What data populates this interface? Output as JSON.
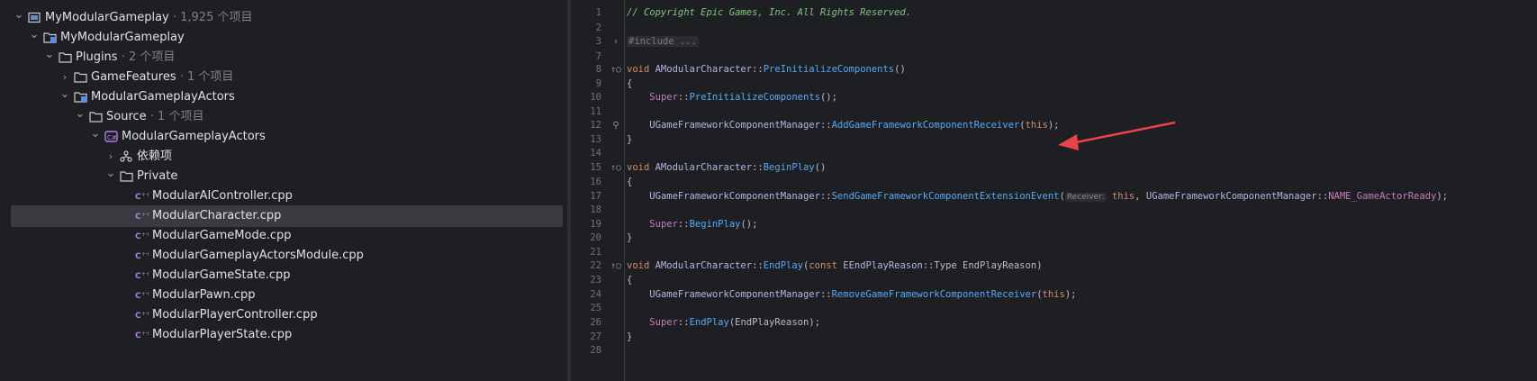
{
  "tree": [
    {
      "label": "MyModularGameplay",
      "meta": "· 1,925 个项目",
      "icon": "solution-icon",
      "chevron": "down",
      "depth": 0
    },
    {
      "label": "MyModularGameplay",
      "meta": "",
      "icon": "project-icon",
      "chevron": "down",
      "depth": 1
    },
    {
      "label": "Plugins",
      "meta": "· 2 个项目",
      "icon": "folder-icon",
      "chevron": "down",
      "depth": 2
    },
    {
      "label": "GameFeatures",
      "meta": "· 1 个项目",
      "icon": "folder-icon",
      "chevron": "right",
      "depth": 3
    },
    {
      "label": "ModularGameplayActors",
      "meta": "",
      "icon": "project-icon",
      "chevron": "down",
      "depth": 3
    },
    {
      "label": "Source",
      "meta": "· 1 个项目",
      "icon": "folder-icon",
      "chevron": "down",
      "depth": 4
    },
    {
      "label": "ModularGameplayActors",
      "meta": "",
      "icon": "cpp-project-icon",
      "chevron": "down",
      "depth": 5
    },
    {
      "label": "依赖项",
      "meta": "",
      "icon": "dependencies-icon",
      "chevron": "right",
      "depth": 6
    },
    {
      "label": "Private",
      "meta": "",
      "icon": "folder-icon",
      "chevron": "down",
      "depth": 6
    },
    {
      "label": "ModularAIController.cpp",
      "meta": "",
      "icon": "cpp-file-icon",
      "chevron": "",
      "depth": 7
    },
    {
      "label": "ModularCharacter.cpp",
      "meta": "",
      "icon": "cpp-file-icon",
      "chevron": "",
      "depth": 7,
      "selected": true
    },
    {
      "label": "ModularGameMode.cpp",
      "meta": "",
      "icon": "cpp-file-icon",
      "chevron": "",
      "depth": 7
    },
    {
      "label": "ModularGameplayActorsModule.cpp",
      "meta": "",
      "icon": "cpp-file-icon",
      "chevron": "",
      "depth": 7
    },
    {
      "label": "ModularGameState.cpp",
      "meta": "",
      "icon": "cpp-file-icon",
      "chevron": "",
      "depth": 7
    },
    {
      "label": "ModularPawn.cpp",
      "meta": "",
      "icon": "cpp-file-icon",
      "chevron": "",
      "depth": 7
    },
    {
      "label": "ModularPlayerController.cpp",
      "meta": "",
      "icon": "cpp-file-icon",
      "chevron": "",
      "depth": 7
    },
    {
      "label": "ModularPlayerState.cpp",
      "meta": "",
      "icon": "cpp-file-icon",
      "chevron": "",
      "depth": 7
    }
  ],
  "code": [
    {
      "ln": "1",
      "gutter": "",
      "tokens": [
        [
          "c-comment",
          "// Copyright Epic Games, Inc. All Rights Reserved."
        ]
      ]
    },
    {
      "ln": "2",
      "gutter": "",
      "tokens": []
    },
    {
      "ln": "3",
      "gutter": "›",
      "tokens": [
        [
          "c-fold",
          "#include ..."
        ]
      ]
    },
    {
      "ln": "7",
      "gutter": "",
      "tokens": []
    },
    {
      "ln": "8",
      "gutter": "↑○",
      "tokens": [
        [
          "c-kw",
          "void "
        ],
        [
          "c-cls",
          "AModularCharacter"
        ],
        [
          "",
          "::"
        ],
        [
          "c-fn",
          "PreInitializeComponents"
        ],
        [
          "",
          "()"
        ]
      ]
    },
    {
      "ln": "9",
      "gutter": "",
      "tokens": [
        [
          "",
          "{"
        ]
      ]
    },
    {
      "ln": "10",
      "gutter": "",
      "tokens": [
        [
          "",
          "    "
        ],
        [
          "c-type",
          "Super"
        ],
        [
          "",
          "::"
        ],
        [
          "c-call",
          "PreInitializeComponents"
        ],
        [
          "",
          "();"
        ]
      ]
    },
    {
      "ln": "11",
      "gutter": "",
      "tokens": []
    },
    {
      "ln": "12",
      "gutter": "⚲",
      "tokens": [
        [
          "",
          "    "
        ],
        [
          "c-cls",
          "UGameFrameworkComponentManager"
        ],
        [
          "",
          "::"
        ],
        [
          "c-call",
          "AddGameFrameworkComponentReceiver"
        ],
        [
          "",
          "("
        ],
        [
          "c-kw",
          "this"
        ],
        [
          "",
          ");"
        ]
      ]
    },
    {
      "ln": "13",
      "gutter": "",
      "tokens": [
        [
          "",
          "}"
        ]
      ]
    },
    {
      "ln": "14",
      "gutter": "",
      "tokens": []
    },
    {
      "ln": "15",
      "gutter": "↑○",
      "tokens": [
        [
          "c-kw",
          "void "
        ],
        [
          "c-cls",
          "AModularCharacter"
        ],
        [
          "",
          "::"
        ],
        [
          "c-fn",
          "BeginPlay"
        ],
        [
          "",
          "()"
        ]
      ]
    },
    {
      "ln": "16",
      "gutter": "",
      "tokens": [
        [
          "",
          "{"
        ]
      ]
    },
    {
      "ln": "17",
      "gutter": "",
      "tokens": [
        [
          "",
          "    "
        ],
        [
          "c-cls",
          "UGameFrameworkComponentManager"
        ],
        [
          "",
          "::"
        ],
        [
          "c-call",
          "SendGameFrameworkComponentExtensionEvent"
        ],
        [
          "",
          "("
        ],
        [
          "hint",
          "Receiver:"
        ],
        [
          "c-kw",
          " this"
        ],
        [
          "",
          ", "
        ],
        [
          "c-cls",
          "UGameFrameworkComponentManager"
        ],
        [
          "",
          "::"
        ],
        [
          "c-mem",
          "NAME_GameActorReady"
        ],
        [
          "",
          ");"
        ]
      ]
    },
    {
      "ln": "18",
      "gutter": "",
      "tokens": []
    },
    {
      "ln": "19",
      "gutter": "",
      "tokens": [
        [
          "",
          "    "
        ],
        [
          "c-type",
          "Super"
        ],
        [
          "",
          "::"
        ],
        [
          "c-call",
          "BeginPlay"
        ],
        [
          "",
          "();"
        ]
      ]
    },
    {
      "ln": "20",
      "gutter": "",
      "tokens": [
        [
          "",
          "}"
        ]
      ]
    },
    {
      "ln": "21",
      "gutter": "",
      "tokens": []
    },
    {
      "ln": "22",
      "gutter": "↑○",
      "tokens": [
        [
          "c-kw",
          "void "
        ],
        [
          "c-cls",
          "AModularCharacter"
        ],
        [
          "",
          "::"
        ],
        [
          "c-fn",
          "EndPlay"
        ],
        [
          "",
          "("
        ],
        [
          "c-kw",
          "const "
        ],
        [
          "c-cls",
          "EEndPlayReason"
        ],
        [
          "",
          "::Type EndPlayReason)"
        ]
      ]
    },
    {
      "ln": "23",
      "gutter": "",
      "tokens": [
        [
          "",
          "{"
        ]
      ]
    },
    {
      "ln": "24",
      "gutter": "",
      "tokens": [
        [
          "",
          "    "
        ],
        [
          "c-cls",
          "UGameFrameworkComponentManager"
        ],
        [
          "",
          "::"
        ],
        [
          "c-call",
          "RemoveGameFrameworkComponentReceiver"
        ],
        [
          "",
          "("
        ],
        [
          "c-kw",
          "this"
        ],
        [
          "",
          ");"
        ]
      ]
    },
    {
      "ln": "25",
      "gutter": "",
      "tokens": []
    },
    {
      "ln": "26",
      "gutter": "",
      "tokens": [
        [
          "",
          "    "
        ],
        [
          "c-type",
          "Super"
        ],
        [
          "",
          "::"
        ],
        [
          "c-call",
          "EndPlay"
        ],
        [
          "",
          "(EndPlayReason);"
        ]
      ]
    },
    {
      "ln": "27",
      "gutter": "",
      "tokens": [
        [
          "",
          "}"
        ]
      ]
    },
    {
      "ln": "28",
      "gutter": "",
      "tokens": []
    }
  ],
  "colors": {
    "background": "#1e1f22",
    "selection": "#393b40",
    "arrow": "#e8434a"
  }
}
